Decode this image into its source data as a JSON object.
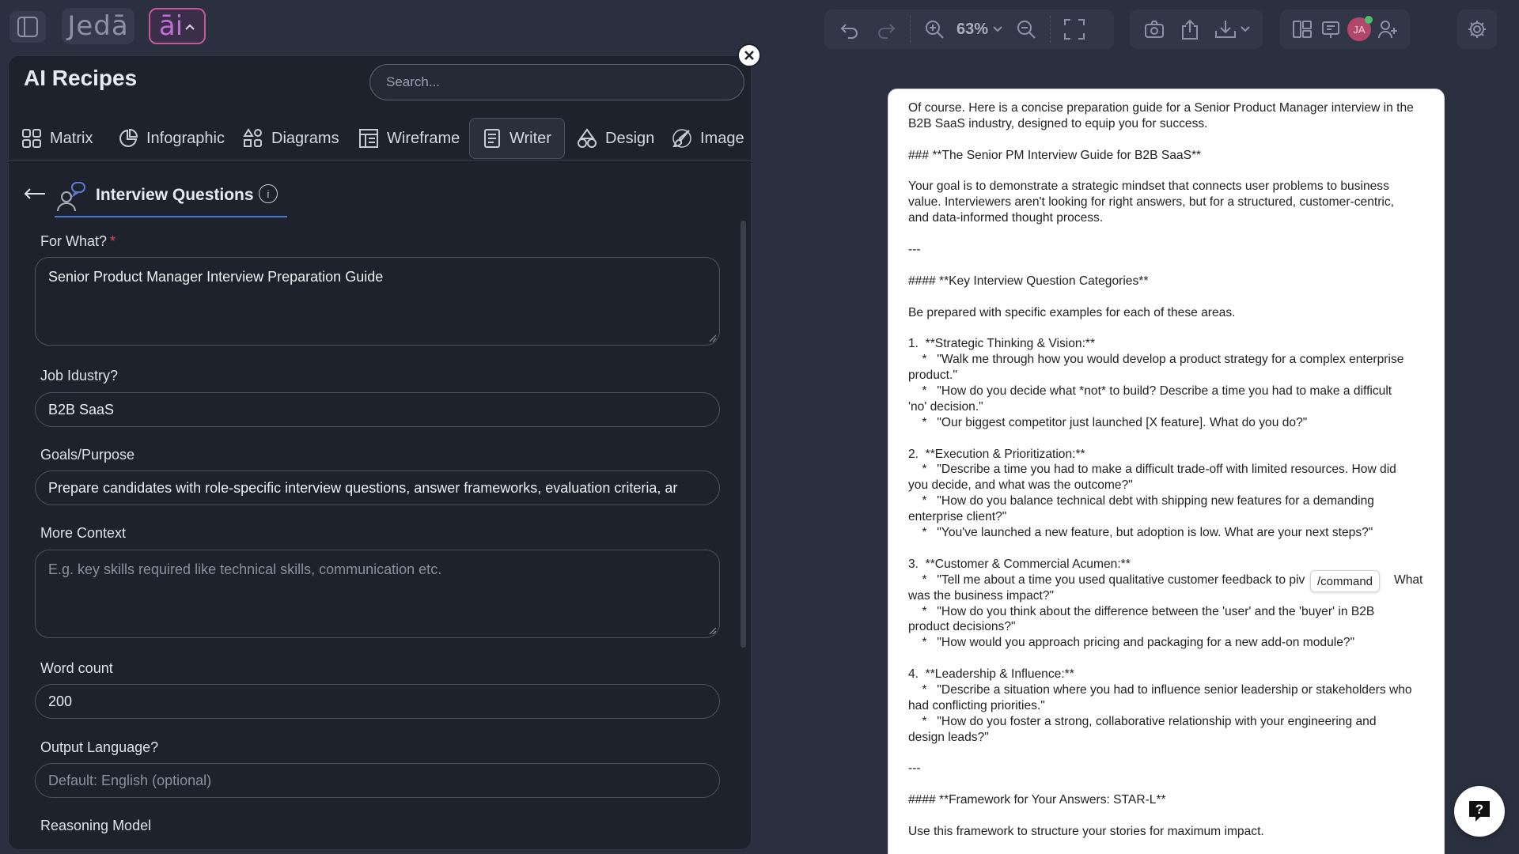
{
  "app": {
    "logo_text": "Jedā",
    "ai_button_text": "āi"
  },
  "toolbar": {
    "zoom_level": "63%"
  },
  "user": {
    "initials": "JA"
  },
  "panel": {
    "title": "AI Recipes",
    "search_placeholder": "Search...",
    "tabs": [
      {
        "label": "Matrix",
        "icon": "grid-icon"
      },
      {
        "label": "Infographic",
        "icon": "pie-chart-icon"
      },
      {
        "label": "Diagrams",
        "icon": "diagram-icon"
      },
      {
        "label": "Wireframe",
        "icon": "wireframe-icon"
      },
      {
        "label": "Writer",
        "icon": "document-text-icon",
        "active": true
      },
      {
        "label": "Design",
        "icon": "shapes-icon"
      },
      {
        "label": "Image",
        "icon": "paint-brush-icon"
      }
    ],
    "recipe_name": "Interview Questions",
    "info_glyph": "i"
  },
  "form": {
    "for_what": {
      "label": "For What?",
      "required_mark": "*",
      "value": "Senior Product Manager Interview Preparation Guide"
    },
    "job_industry": {
      "label": "Job Idustry?",
      "value": "B2B SaaS"
    },
    "goals": {
      "label": "Goals/Purpose",
      "value": "Prepare candidates with role-specific interview questions, answer frameworks, evaluation criteria, ar"
    },
    "more_context": {
      "label": "More Context",
      "placeholder": "E.g. key skills required like technical skills, communication etc."
    },
    "word_count": {
      "label": "Word count",
      "value": "200"
    },
    "output_language": {
      "label": "Output Language?",
      "placeholder": "Default: English (optional)"
    },
    "reasoning_model": {
      "label": "Reasoning Model"
    }
  },
  "document": {
    "lines": [
      "Of course. Here is a concise preparation guide for a Senior Product Manager interview in the",
      "B2B SaaS industry, designed to equip you for success.",
      "",
      "### **The Senior PM Interview Guide for B2B SaaS**",
      "",
      "Your goal is to demonstrate a strategic mindset that connects user problems to business",
      "value. Interviewers aren't looking for right answers, but for a structured, customer-centric,",
      "and data-informed thought process.",
      "",
      "---",
      "",
      "#### **Key Interview Question Categories**",
      "",
      "Be prepared with specific examples for each of these areas.",
      "",
      "1.  **Strategic Thinking & Vision:**",
      "    *   \"Walk me through how you would develop a product strategy for a complex enterprise",
      "product.\"",
      "    *   \"How do you decide what *not* to build? Describe a time you had to make a difficult",
      "'no' decision.\"",
      "    *   \"Our biggest competitor just launched [X feature]. What do you do?\"",
      "",
      "2.  **Execution & Prioritization:**",
      "    *   \"Describe a time you had to make a difficult trade-off with limited resources. How did",
      "you decide, and what was the outcome?\"",
      "    *   \"How do you balance technical debt with shipping new features for a demanding",
      "enterprise client?\"",
      "    *   \"You've launched a new feature, but adoption is low. What are your next steps?\"",
      "",
      "3.  **Customer & Commercial Acumen:**",
      "    *   \"Tell me about a time you used qualitative customer feedback to piv                          What",
      "was the business impact?\"",
      "    *   \"How do you think about the difference between the 'user' and the 'buyer' in B2B",
      "product decisions?\"",
      "    *   \"How would you approach pricing and packaging for a new add-on module?\"",
      "",
      "4.  **Leadership & Influence:**",
      "    *   \"Describe a situation where you had to influence senior leadership or stakeholders who",
      "had conflicting priorities.\"",
      "    *   \"How do you foster a strong, collaborative relationship with your engineering and",
      "design leads?\"",
      "",
      "---",
      "",
      "#### **Framework for Your Answers: STAR-L**",
      "",
      "Use this framework to structure your stories for maximum impact."
    ],
    "command_tooltip": "/command"
  },
  "help": {
    "glyph": "?"
  }
}
